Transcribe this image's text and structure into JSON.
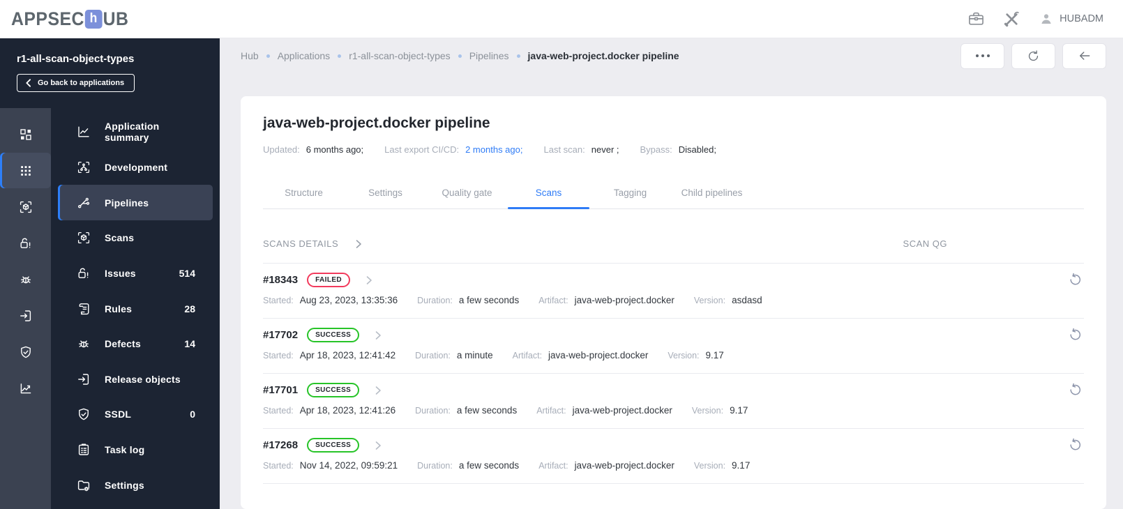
{
  "header": {
    "logo_prefix": "APPSEC",
    "logo_h": "h",
    "logo_suffix": "UB",
    "username": "HUBADM",
    "icons": [
      "briefcase-icon",
      "tools-icon",
      "user-icon"
    ]
  },
  "sidebar": {
    "app_name": "r1-all-scan-object-types",
    "back_button_label": "Go back to applications",
    "rail_icons": [
      "dashboard-icon",
      "apps-grid-icon",
      "scan-cube-icon",
      "lock-icon",
      "bug-icon",
      "release-box-icon",
      "shield-check-icon",
      "chart-icon"
    ],
    "rail_active_index": 1,
    "menu": [
      {
        "label": "Application summary",
        "icon": "chart-line-icon"
      },
      {
        "label": "Development",
        "icon": "branch-icon"
      },
      {
        "label": "Pipelines",
        "icon": "pipeline-icon",
        "active": true
      },
      {
        "label": "Scans",
        "icon": "scan-cube-icon"
      },
      {
        "label": "Issues",
        "icon": "lock-icon",
        "badge": "514"
      },
      {
        "label": "Rules",
        "icon": "rules-scroll-icon",
        "badge": "28"
      },
      {
        "label": "Defects",
        "icon": "bug-icon",
        "badge": "14"
      },
      {
        "label": "Release objects",
        "icon": "release-box-icon"
      },
      {
        "label": "SSDL",
        "icon": "shield-check-icon",
        "badge": "0"
      },
      {
        "label": "Task log",
        "icon": "task-log-icon"
      },
      {
        "label": "Settings",
        "icon": "folder-settings-icon"
      }
    ]
  },
  "breadcrumb": {
    "items": [
      "Hub",
      "Applications",
      "r1-all-scan-object-types",
      "Pipelines"
    ],
    "current": "java-web-project.docker pipeline"
  },
  "toolbar_icons": [
    "more-options-icon",
    "refresh-icon",
    "back-arrow-icon"
  ],
  "page": {
    "title": "java-web-project.docker pipeline",
    "meta": [
      {
        "label": "Updated:",
        "value": "6 months ago;"
      },
      {
        "label": "Last export CI/CD:",
        "value": "2 months ago;",
        "link": true
      },
      {
        "label": "Last scan:",
        "value": "never ;"
      },
      {
        "label": "Bypass:",
        "value": "Disabled;"
      }
    ],
    "tabs": [
      "Structure",
      "Settings",
      "Quality gate",
      "Scans",
      "Tagging",
      "Child pipelines"
    ],
    "active_tab": "Scans"
  },
  "scans": {
    "section_title": "SCANS DETAILS",
    "qg_column": "SCAN QG",
    "labels": {
      "started": "Started:",
      "duration": "Duration:",
      "artifact": "Artifact:",
      "version": "Version:"
    },
    "rows": [
      {
        "id": "#18343",
        "status": "FAILED",
        "started": "Aug 23, 2023, 13:35:36",
        "duration": "a few seconds",
        "artifact": "java-web-project.docker",
        "version": "asdasd"
      },
      {
        "id": "#17702",
        "status": "SUCCESS",
        "started": "Apr 18, 2023, 12:41:42",
        "duration": "a minute",
        "artifact": "java-web-project.docker",
        "version": "9.17"
      },
      {
        "id": "#17701",
        "status": "SUCCESS",
        "started": "Apr 18, 2023, 12:41:26",
        "duration": "a few seconds",
        "artifact": "java-web-project.docker",
        "version": "9.17"
      },
      {
        "id": "#17268",
        "status": "SUCCESS",
        "started": "Nov 14, 2022, 09:59:21",
        "duration": "a few seconds",
        "artifact": "java-web-project.docker",
        "version": "9.17"
      }
    ]
  },
  "colors": {
    "accent_blue": "#2f7cf6",
    "failed_red": "#f23a5c",
    "success_green": "#27c428",
    "sidebar_dark": "#1c2433",
    "rail_gray": "#3b4251",
    "logo_blue": "#7c90da",
    "active_item_bg": "#3a4255"
  }
}
